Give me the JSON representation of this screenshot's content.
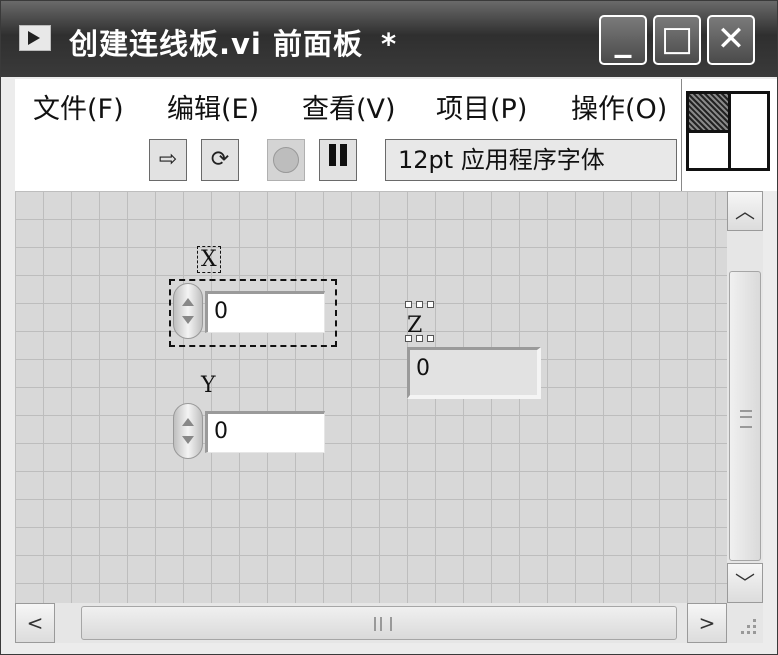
{
  "window": {
    "title": "创建连线板.vi 前面板",
    "modified_marker": "*"
  },
  "menu": {
    "items": [
      {
        "label": "文件(F)"
      },
      {
        "label": "编辑(E)"
      },
      {
        "label": "查看(V)"
      },
      {
        "label": "项目(P)"
      },
      {
        "label": "操作(O)"
      }
    ]
  },
  "toolbar": {
    "font_selector": "12pt 应用程序字体"
  },
  "controls": {
    "x": {
      "label": "X",
      "value": "0"
    },
    "y": {
      "label": "Y",
      "value": "0"
    },
    "z": {
      "label": "Z",
      "value": "0"
    }
  },
  "icons": [
    "vi-front-panel-icon",
    "minimize-icon",
    "maximize-icon",
    "close-icon",
    "run-arrow-icon",
    "run-continuously-icon",
    "abort-execution-icon",
    "pause-icon",
    "connector-pane-icon",
    "scroll-up-icon",
    "scroll-down-icon",
    "scroll-left-icon",
    "scroll-right-icon"
  ]
}
